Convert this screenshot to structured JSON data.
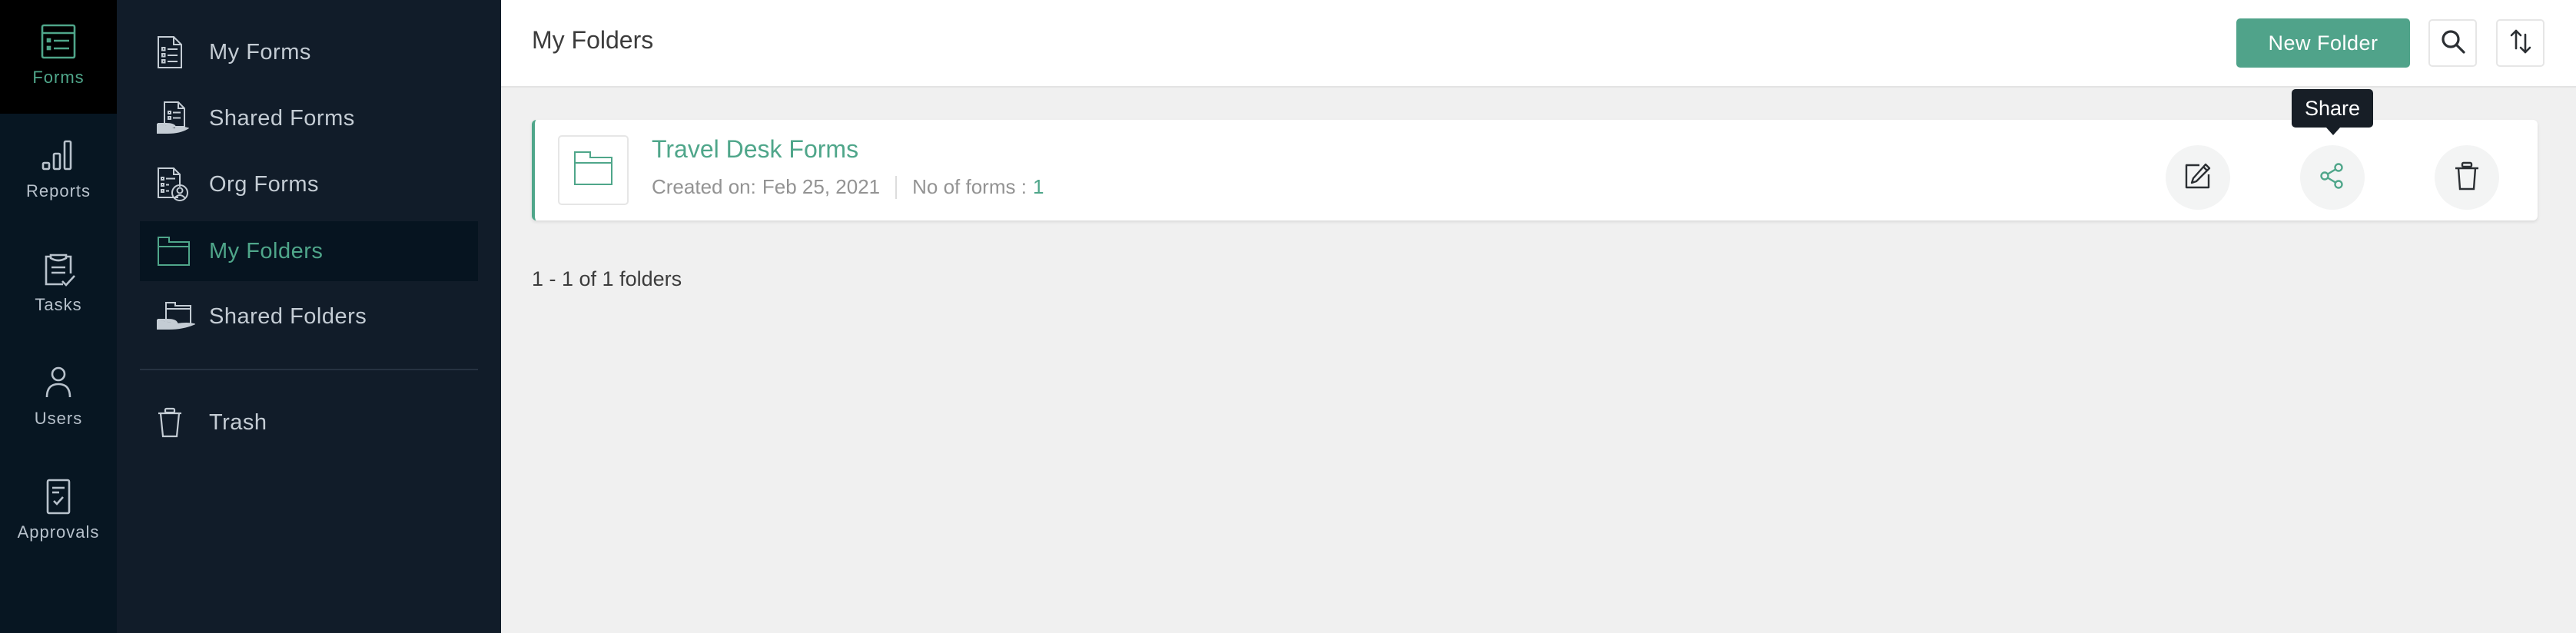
{
  "colors": {
    "accent": "#4fa68a",
    "rail_bg": "#071622",
    "sidebar_bg": "#111c29",
    "active_bg": "#061420",
    "tooltip_bg": "#171e26"
  },
  "rail": {
    "items": [
      {
        "label": "Forms",
        "icon": "form-list-icon",
        "active": true
      },
      {
        "label": "Reports",
        "icon": "bar-chart-icon",
        "active": false
      },
      {
        "label": "Tasks",
        "icon": "clipboard-check-icon",
        "active": false
      },
      {
        "label": "Users",
        "icon": "user-icon",
        "active": false
      },
      {
        "label": "Approvals",
        "icon": "approval-document-icon",
        "active": false
      }
    ]
  },
  "sidebar": {
    "items": [
      {
        "label": "My Forms",
        "icon": "form-document-icon",
        "active": false
      },
      {
        "label": "Shared Forms",
        "icon": "shared-form-icon",
        "active": false
      },
      {
        "label": "Org Forms",
        "icon": "org-form-icon",
        "active": false
      },
      {
        "label": "My Folders",
        "icon": "folder-icon",
        "active": true
      },
      {
        "label": "Shared Folders",
        "icon": "shared-folder-icon",
        "active": false
      }
    ],
    "trash": {
      "label": "Trash",
      "icon": "trash-icon"
    }
  },
  "header": {
    "title": "My Folders",
    "new_folder_label": "New Folder",
    "search_icon": "search-icon",
    "sort_icon": "sort-icon"
  },
  "folders": [
    {
      "name": "Travel Desk Forms",
      "created_label": "Created on:",
      "created_date": "Feb 25, 2021",
      "count_label": "No of forms :",
      "count": "1",
      "actions": [
        "Edit",
        "Share",
        "Delete"
      ]
    }
  ],
  "tooltip": {
    "text": "Share"
  },
  "pagination": {
    "text": "1 - 1 of 1 folders"
  }
}
